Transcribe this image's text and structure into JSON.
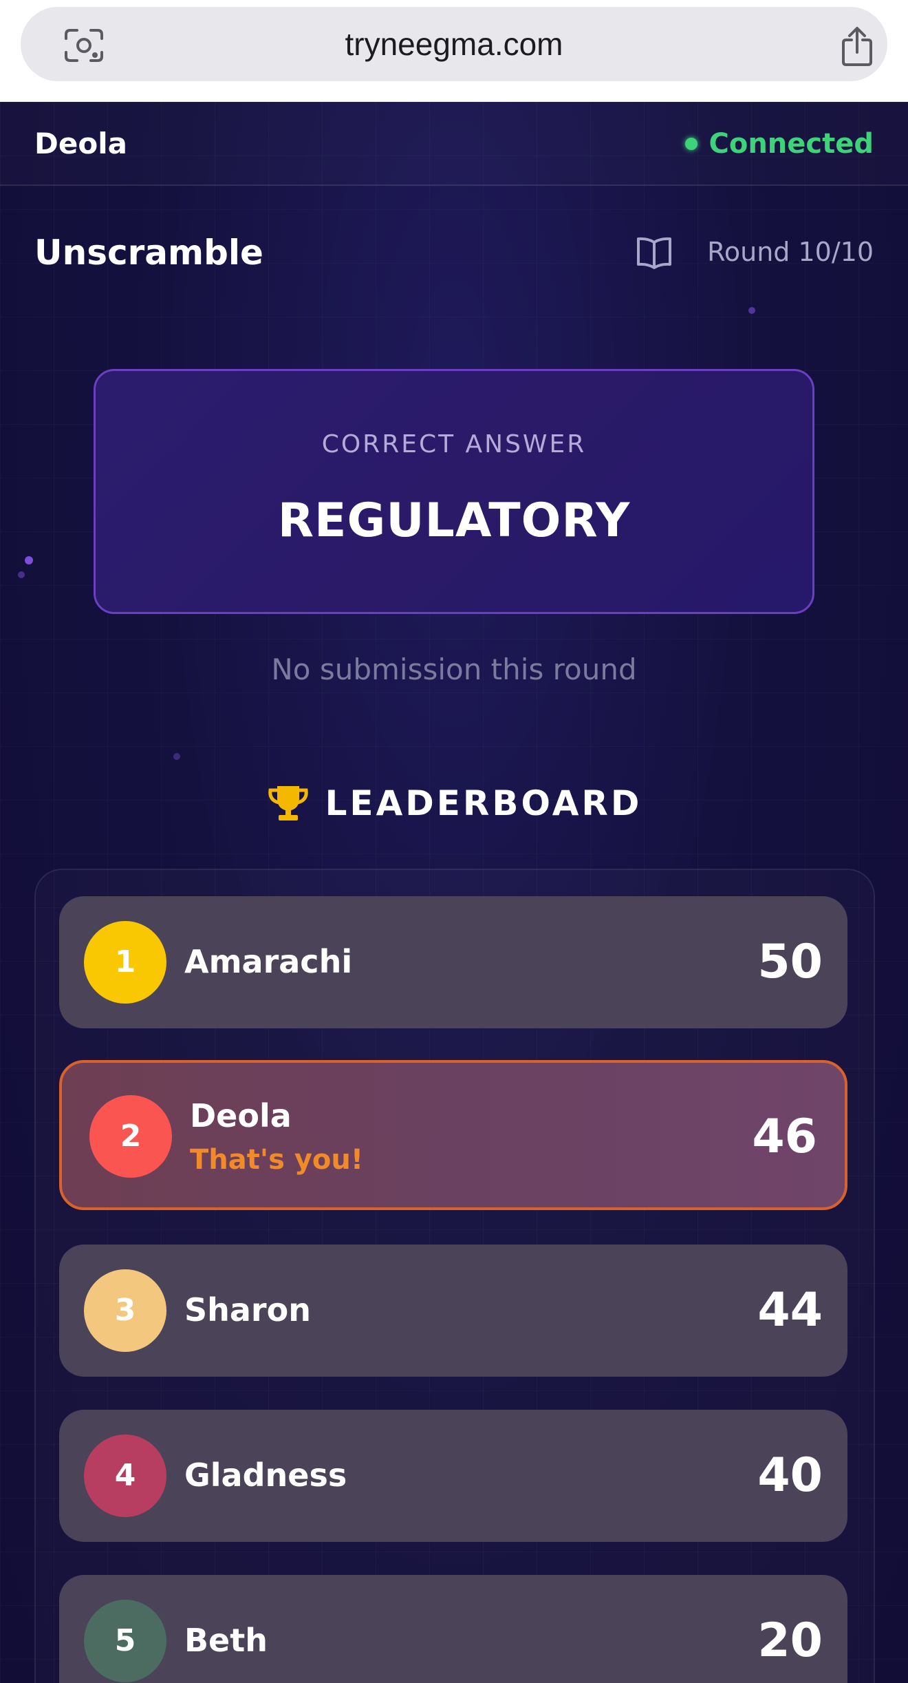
{
  "browser": {
    "url": "tryneegma.com"
  },
  "header": {
    "player_name": "Deola",
    "status": "Connected",
    "status_color": "#3ed27a"
  },
  "game": {
    "title": "Unscramble",
    "round": "Round 10/10"
  },
  "answer": {
    "caption": "CORRECT ANSWER",
    "word": "REGULATORY"
  },
  "submission_status": "No submission this round",
  "leaderboard": {
    "title": "LEADERBOARD",
    "you_label": "That's you!",
    "entries": [
      {
        "rank": "1",
        "name": "Amarachi",
        "score": "50",
        "color": "#f9c802"
      },
      {
        "rank": "2",
        "name": "Deola",
        "score": "46",
        "color": "#fb5552",
        "is_you": true
      },
      {
        "rank": "3",
        "name": "Sharon",
        "score": "44",
        "color": "#f3c77e"
      },
      {
        "rank": "4",
        "name": "Gladness",
        "score": "40",
        "color": "#b73e60"
      },
      {
        "rank": "5",
        "name": "Beth",
        "score": "20",
        "color": "#4c6b61"
      }
    ]
  }
}
